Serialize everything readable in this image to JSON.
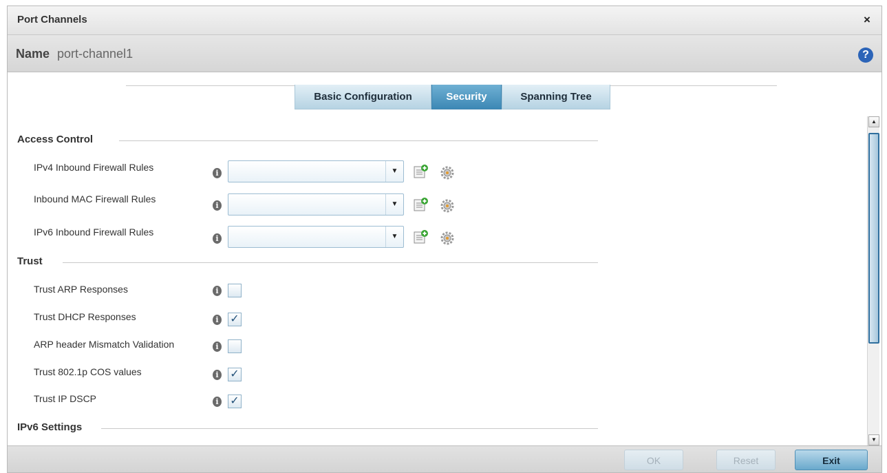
{
  "dialog": {
    "title": "Port Channels",
    "close_glyph": "×",
    "name_label": "Name",
    "name_value": "port-channel1",
    "help_glyph": "?"
  },
  "tabs": [
    {
      "label": "Basic Configuration",
      "active": false
    },
    {
      "label": "Security",
      "active": true
    },
    {
      "label": "Spanning Tree",
      "active": false
    }
  ],
  "sections": {
    "access_control": {
      "title": "Access Control",
      "rows": [
        {
          "label": "IPv4 Inbound Firewall Rules",
          "value": ""
        },
        {
          "label": "Inbound MAC Firewall Rules",
          "value": ""
        },
        {
          "label": "IPv6 Inbound Firewall Rules",
          "value": ""
        }
      ]
    },
    "trust": {
      "title": "Trust",
      "rows": [
        {
          "label": "Trust ARP Responses",
          "checked": false
        },
        {
          "label": "Trust DHCP Responses",
          "checked": true
        },
        {
          "label": "ARP header Mismatch Validation",
          "checked": false
        },
        {
          "label": "Trust 802.1p COS values",
          "checked": true
        },
        {
          "label": "Trust IP DSCP",
          "checked": true
        }
      ]
    },
    "ipv6": {
      "title": "IPv6 Settings"
    }
  },
  "icons": {
    "info": "i",
    "dropdown": "▼",
    "check": "✓",
    "scroll_up": "▲",
    "scroll_down": "▼"
  },
  "footer": {
    "ok_label": "OK",
    "reset_label": "Reset",
    "exit_label": "Exit"
  },
  "colors": {
    "accent_tab": "#3d88b5",
    "help_icon": "#2c64b8",
    "scroll_thumb_border": "#2f6f9e"
  }
}
